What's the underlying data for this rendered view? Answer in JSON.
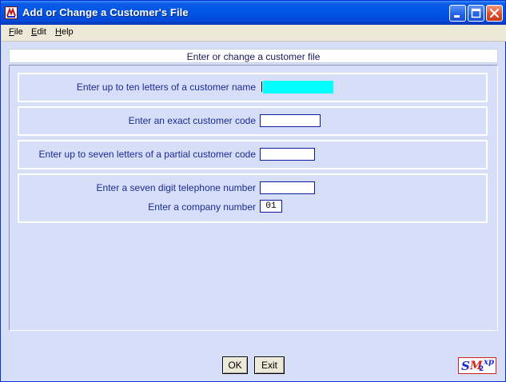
{
  "window": {
    "title": "Add or Change a Customer's File",
    "buttons": [
      "minimize",
      "maximize",
      "close"
    ]
  },
  "menu": {
    "file": {
      "mnemonic": "F",
      "rest": "ile"
    },
    "edit": {
      "mnemonic": "E",
      "rest": "dit"
    },
    "help": {
      "mnemonic": "H",
      "rest": "elp"
    }
  },
  "header": "Enter or change a customer file",
  "fields": {
    "customer_name": {
      "label": "Enter up to ten letters of a customer name",
      "value": ""
    },
    "customer_code": {
      "label": "Enter an exact customer code",
      "value": ""
    },
    "partial_code": {
      "label": "Enter up to seven letters of a partial customer code",
      "value": ""
    },
    "telephone": {
      "label": "Enter a seven digit telephone number",
      "value": ""
    },
    "company_number": {
      "label": "Enter a company number",
      "value": "01"
    }
  },
  "buttons": {
    "ok": "OK",
    "exit": "Exit"
  },
  "logo": {
    "s": "S",
    "m": "M",
    "two": "2",
    "xp": "xp"
  },
  "colors": {
    "background": "#d6dff7",
    "label_text": "#1b2a96",
    "active_field": "#00ffff",
    "title_bar": "#0055e5"
  },
  "icons": {
    "app": "app-icon",
    "minimize": "minimize-icon",
    "maximize": "maximize-icon",
    "close": "close-icon"
  }
}
